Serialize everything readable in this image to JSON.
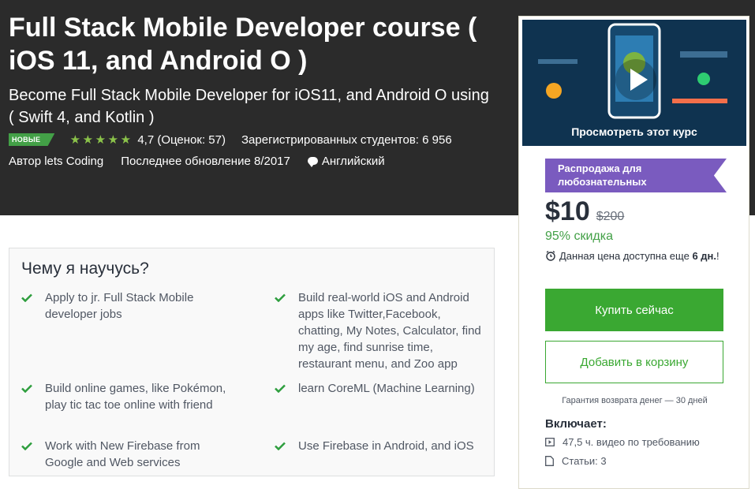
{
  "course": {
    "title": "Full Stack Mobile Developer course ( iOS 11, and Android O )",
    "subtitle": "Become Full Stack Mobile Developer for iOS11, and Android O using ( Swift 4, and Kotlin )",
    "badge": "НОВЫЕ",
    "rating_value": 4.7,
    "rating_text": "4,7 (Оценок: 57)",
    "students": "Зарегистрированных студентов: 6 956",
    "author": "Автор lets Coding",
    "updated": "Последнее обновление 8/2017",
    "language": "Английский"
  },
  "learn": {
    "heading": "Чему я научусь?",
    "items": [
      "Apply to jr. Full Stack Mobile developer jobs",
      "Build real-world iOS and Android apps like Twitter,Facebook, chatting, My Notes, Calculator, find my age, find sunrise time, restaurant menu, and Zoo app",
      "Build online games, like Pokémon, play tic tac toe online with friend",
      "learn CoreML (Machine Learning)",
      "Work with New Firebase from Google and Web services",
      "Use Firebase in Android, and iOS"
    ]
  },
  "sidebar": {
    "preview_label": "Просмотреть этот курс",
    "sale_banner": "Распродажа для любознательных",
    "price": "$10",
    "old_price": "$200",
    "discount": "95% скидка",
    "timer_prefix": "Данная цена доступна еще",
    "timer_days": "6 дн.",
    "timer_suffix": "!",
    "buy_button": "Купить сейчас",
    "cart_button": "Добавить в корзину",
    "guarantee": "Гарантия возврата денег — 30 дней",
    "includes_heading": "Включает:",
    "includes": [
      "47,5 ч. видео по требованию",
      "Статьи: 3"
    ]
  },
  "colors": {
    "hero_bg": "#2b2b2b",
    "accent_green": "#3aa832",
    "star_green": "#8bc34a",
    "sale_purple": "#7a5bbf"
  }
}
